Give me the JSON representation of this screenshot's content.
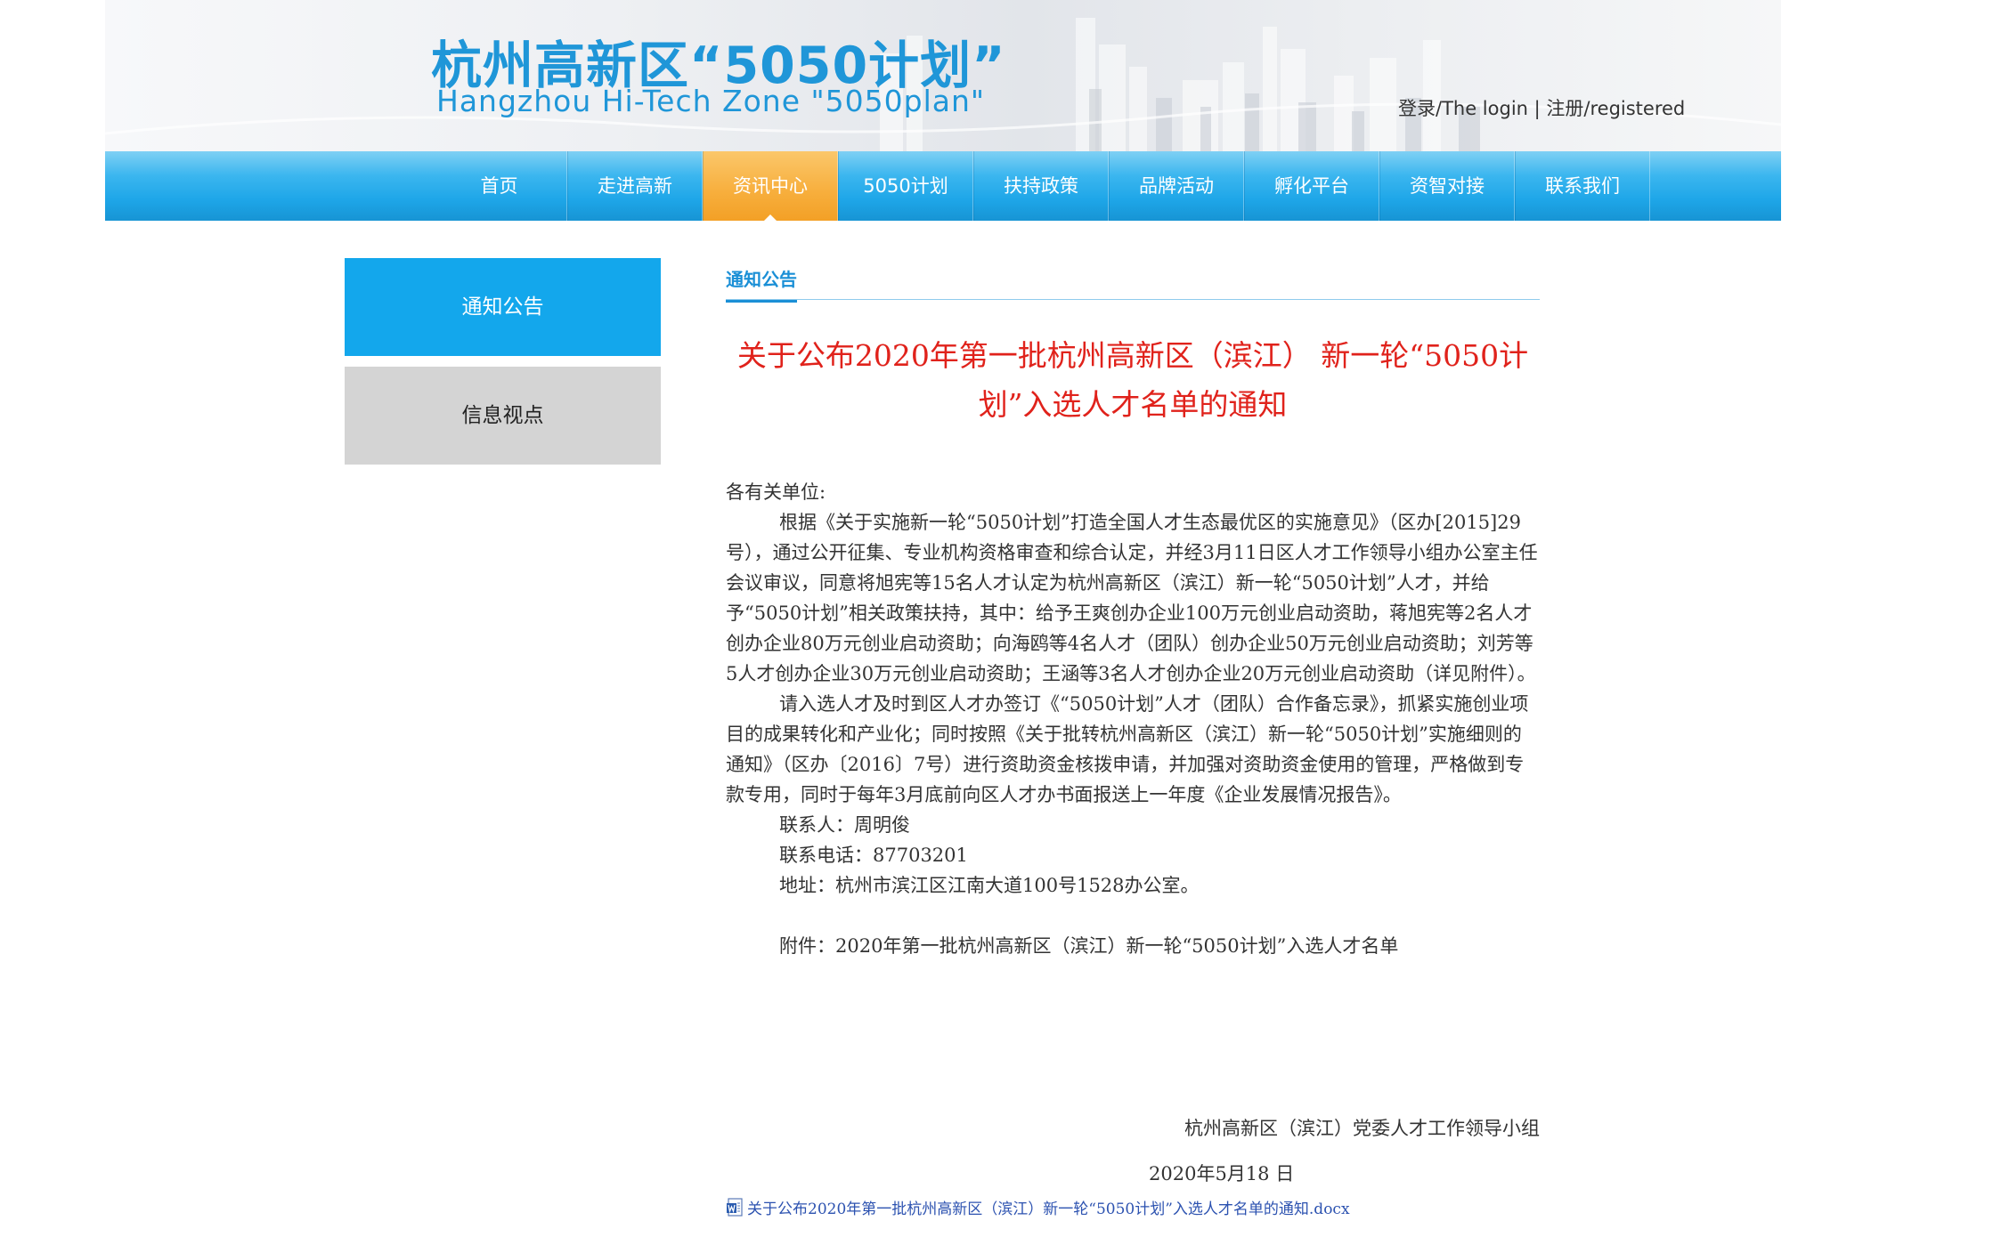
{
  "header": {
    "logo_cn": "杭州高新区“5050计划”",
    "logo_en": "Hangzhou Hi-Tech Zone \"5050plan\"",
    "login_label": "登录/The login",
    "separator": " | ",
    "register_label": "注册/registered"
  },
  "nav": {
    "items": [
      "首页",
      "走进高新",
      "资讯中心",
      "5050计划",
      "扶持政策",
      "品牌活动",
      "孵化平台",
      "资智对接",
      "联系我们"
    ],
    "active": "资讯中心",
    "active_color": "#f7ae3c",
    "bar_color": "#1ea6e8"
  },
  "sidebar": {
    "items": [
      "通知公告",
      "信息视点"
    ]
  },
  "main": {
    "section_title": "通知公告",
    "article_title_line1": "关于公布2020年第一批杭州高新区（滨江） 新一轮“5050计",
    "article_title_line2": "划”入选人才名单的通知",
    "title_color": "#e0221b",
    "greeting": "各有关单位:",
    "para1": "根据《关于实施新一轮“5050计划”打造全国人才生态最优区的实施意见》（区办[2015]29号），通过公开征集、专业机构资格审查和综合认定，并经3月11日区人才工作领导小组办公室主任会议审议，同意将旭宪等15名人才认定为杭州高新区（滨江）新一轮“5050计划”人才，并给予“5050计划”相关政策扶持，其中：给予王爽创办企业100万元创业启动资助，蒋旭宪等2名人才创办企业80万元创业启动资助；向海鸥等4名人才（团队）创办企业50万元创业启动资助；刘芳等5人才创办企业30万元创业启动资助；王涵等3名人才创办企业20万元创业启动资助（详见附件）。",
    "para2": "请入选人才及时到区人才办签订《“5050计划”人才（团队）合作备忘录》，抓紧实施创业项目的成果转化和产业化；同时按照《关于批转杭州高新区（滨江）新一轮“5050计划”实施细则的通知》（区办〔2016〕7号）进行资助资金核拨申请，并加强对资助资金使用的管理，严格做到专款专用，同时于每年3月底前向区人才办书面报送上一年度《企业发展情况报告》。",
    "contact": "联系人：周明俊",
    "phone": "联系电话：87703201",
    "address": "地址：杭州市滨江区江南大道100号1528办公室。",
    "attachment": "附件：2020年第一批杭州高新区（滨江）新一轮“5050计划”入选人才名单",
    "signature": "杭州高新区（滨江）党委人才工作领导小组",
    "date": "2020年5月18 日",
    "attachment_file": "关于公布2020年第一批杭州高新区（滨江）新一轮“5050计划”入选人才名单的通知.docx"
  }
}
